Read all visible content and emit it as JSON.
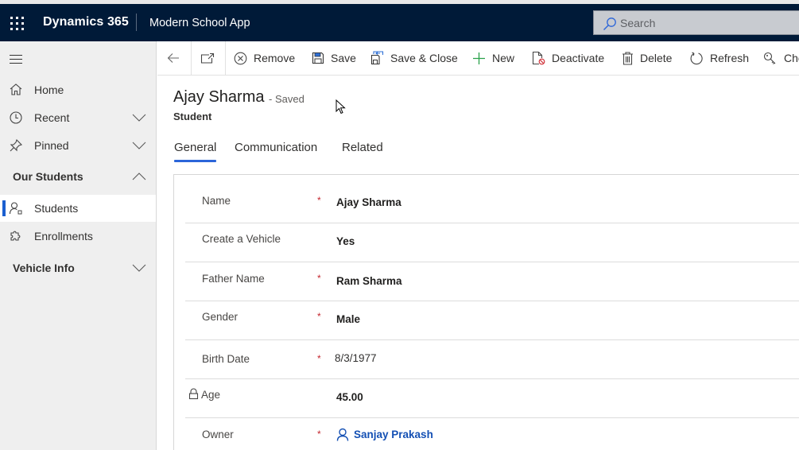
{
  "topbar": {
    "brand": "Dynamics 365",
    "app_name": "Modern School App",
    "search_placeholder": "Search"
  },
  "sidebar": {
    "items": [
      {
        "label": "Home",
        "icon": "home-icon"
      },
      {
        "label": "Recent",
        "icon": "clock-icon",
        "expandable": true
      },
      {
        "label": "Pinned",
        "icon": "pin-icon",
        "expandable": true
      }
    ],
    "groups": [
      {
        "label": "Our Students",
        "expanded": true,
        "items": [
          {
            "label": "Students",
            "icon": "person-icon",
            "selected": true
          },
          {
            "label": "Enrollments",
            "icon": "puzzle-icon"
          }
        ]
      },
      {
        "label": "Vehicle Info",
        "expanded": false,
        "items": []
      }
    ]
  },
  "toolbar": {
    "buttons": [
      {
        "label": "Remove",
        "icon": "remove-circle-icon"
      },
      {
        "label": "Save",
        "icon": "save-icon"
      },
      {
        "label": "Save & Close",
        "icon": "save-close-icon"
      },
      {
        "label": "New",
        "icon": "plus-icon"
      },
      {
        "label": "Deactivate",
        "icon": "deactivate-icon"
      },
      {
        "label": "Delete",
        "icon": "trash-icon"
      },
      {
        "label": "Refresh",
        "icon": "refresh-icon"
      },
      {
        "label": "Che",
        "icon": "key-icon"
      }
    ]
  },
  "record": {
    "title": "Ajay Sharma",
    "status": "- Saved",
    "entity": "Student"
  },
  "tabs": [
    {
      "label": "General",
      "active": true
    },
    {
      "label": "Communication",
      "active": false
    },
    {
      "label": "Related",
      "active": false
    }
  ],
  "form": {
    "required_marker": "*",
    "fields": [
      {
        "label": "Name",
        "value": "Ajay Sharma",
        "required": true
      },
      {
        "label": "Create a Vehicle",
        "value": "Yes",
        "required": false
      },
      {
        "label": "Father Name",
        "value": "Ram Sharma",
        "required": true
      },
      {
        "label": "Gender",
        "value": "Male",
        "required": true
      },
      {
        "label": "Birth Date",
        "value": "8/3/1977",
        "required": true
      },
      {
        "label": "Age",
        "value": "45.00",
        "required": false,
        "locked": true
      },
      {
        "label": "Owner",
        "value": "Sanjay Prakash",
        "required": true,
        "lookup": true
      }
    ]
  },
  "colors": {
    "topbar": "#001a38",
    "accent": "#2b65d9",
    "required": "#c4262e",
    "link": "#1450b4"
  }
}
